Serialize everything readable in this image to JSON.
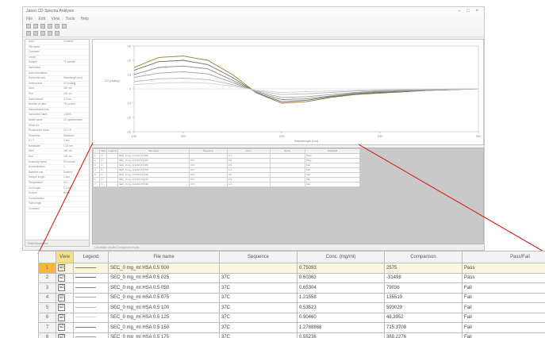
{
  "window": {
    "title": "Jasco CD Spectra Analysis",
    "controls": "– □ ×",
    "menu": [
      "File",
      "Edit",
      "View",
      "Tools",
      "Help"
    ]
  },
  "properties": {
    "rows": [
      {
        "k": "Data",
        "v": "Contents"
      },
      {
        "k": "File name",
        "v": ""
      },
      {
        "k": "Comment",
        "v": ""
      },
      {
        "k": "Owner",
        "v": ""
      },
      {
        "k": "Sample",
        "v": "TF sample"
      },
      {
        "k": "Instrument",
        "v": ""
      },
      {
        "k": "Data information",
        "v": ""
      },
      {
        "k": "Horizontal axis",
        "v": "Wavelength [nm]"
      },
      {
        "k": "Vertical axis",
        "v": "CD [mdeg]"
      },
      {
        "k": "Start",
        "v": "260 nm"
      },
      {
        "k": "End",
        "v": "190 nm"
      },
      {
        "k": "Data interval",
        "v": "0.1 nm"
      },
      {
        "k": "Number of data",
        "v": "701 points"
      },
      {
        "k": "Measurement info",
        "v": ""
      },
      {
        "k": "Instrument name",
        "v": "J-1500"
      },
      {
        "k": "Model name",
        "v": "CD spectrometer"
      },
      {
        "k": "Serial No.",
        "v": ""
      },
      {
        "k": "Photometric mode",
        "v": "CD, HT"
      },
      {
        "k": "Sensitivity",
        "v": "Standard"
      },
      {
        "k": "D.I.T.",
        "v": "2 sec"
      },
      {
        "k": "Bandwidth",
        "v": "1.00 nm"
      },
      {
        "k": "Start",
        "v": "260 nm"
      },
      {
        "k": "End",
        "v": "190 nm"
      },
      {
        "k": "Scanning speed",
        "v": "50 nm/min"
      },
      {
        "k": "Accumulations",
        "v": "1"
      },
      {
        "k": "Baseline corr.",
        "v": "Solvent"
      },
      {
        "k": "Sample length",
        "v": "1 mm"
      },
      {
        "k": "Temperature",
        "v": "25 C"
      },
      {
        "k": "Cell length",
        "v": "0.1 cm"
      },
      {
        "k": "Solvent",
        "v": "Buffer"
      },
      {
        "k": "Concentration",
        "v": ""
      },
      {
        "k": "Path length",
        "v": ""
      },
      {
        "k": "Comment",
        "v": ""
      }
    ],
    "bottom_tab": "Data information"
  },
  "chart_data": {
    "type": "line",
    "xlabel": "Wavelength [nm]",
    "ylabel": "CD [mdeg]",
    "xlim": [
      190,
      260
    ],
    "ylim": [
      -30,
      30
    ],
    "x_ticks": [
      "190",
      "200",
      "220",
      "240",
      "260"
    ],
    "y_ticks": [
      "30",
      "20",
      "10",
      "0",
      "-10",
      "-20",
      "-30"
    ],
    "x": [
      190,
      195,
      200,
      205,
      210,
      215,
      220,
      225,
      230,
      235,
      240,
      245,
      250,
      255,
      260
    ],
    "series": [
      {
        "color": "#9a7a28",
        "values": [
          15,
          22,
          23,
          20,
          10,
          -3,
          -10,
          -9,
          -6,
          -4,
          -3,
          -2,
          -1,
          -0.5,
          0
        ]
      },
      {
        "color": "#6b6b6b",
        "values": [
          13,
          19,
          20,
          17,
          8,
          -3,
          -9,
          -8,
          -5.5,
          -3.5,
          -2.5,
          -2,
          -1,
          -0.5,
          0
        ]
      },
      {
        "color": "#8a8a8a",
        "values": [
          10,
          15,
          16,
          14,
          6,
          -2.5,
          -7.5,
          -7,
          -5,
          -3,
          -2,
          -1.5,
          -1,
          -0.5,
          0
        ]
      },
      {
        "color": "#a0a0a0",
        "values": [
          8,
          11,
          12,
          10.5,
          4.5,
          -2,
          -6,
          -5.5,
          -4,
          -2.5,
          -1.5,
          -1,
          -0.5,
          -0.3,
          0
        ]
      },
      {
        "color": "#b8b8b8",
        "values": [
          5,
          7,
          7.5,
          6.5,
          3,
          -1.5,
          -4,
          -3.5,
          -2.5,
          -1.5,
          -1,
          -0.6,
          -0.3,
          -0.1,
          0
        ]
      },
      {
        "color": "#cfcfcf",
        "values": [
          3,
          4,
          4.5,
          4,
          2,
          -1,
          -2.5,
          -2,
          -1.5,
          -1,
          -0.6,
          -0.3,
          -0.2,
          -0.1,
          0
        ]
      }
    ]
  },
  "small_table": {
    "columns": [
      "",
      "View",
      "Legend",
      "File name",
      "Sequence",
      "Conc.",
      "Comp.",
      "Pass/Fail"
    ],
    "rows": [
      [
        "1",
        "☑",
        "",
        "SEC_0 mg_ml HSA 0.5 000",
        "",
        "0.7",
        "",
        "Pass"
      ],
      [
        "2",
        "☑",
        "",
        "SEC_0 mg_ml HSA 0.5 025",
        "37C",
        "0.6",
        "",
        "Pass"
      ],
      [
        "3",
        "☑",
        "",
        "SEC_0 mg_ml HSA 0.5 050",
        "37C",
        "0.6",
        "",
        "Fail"
      ],
      [
        "4",
        "☑",
        "",
        "SEC_0 mg_ml HSA 0.5 075",
        "37C",
        "1.2",
        "",
        "Fail"
      ],
      [
        "5",
        "☑",
        "",
        "SEC_0 mg_ml HSA 0.5 100",
        "37C",
        "0.5",
        "",
        "Fail"
      ],
      [
        "6",
        "☑",
        "",
        "SEC_0 mg_ml HSA 0.5 125",
        "37C",
        "0.9",
        "",
        "Fail"
      ],
      [
        "7",
        "☑",
        "",
        "SEC_0 mg_ml HSA 0.5 150",
        "37C",
        "1.2",
        "",
        "Fail"
      ]
    ]
  },
  "statusbar": "Calculation results   Comparison results",
  "big_table": {
    "columns": [
      "",
      "View",
      "Legend",
      "File name",
      "Sequence",
      "Conc. (mg/ml)",
      "Comparison",
      "Pass/Fail"
    ],
    "rows": [
      {
        "n": "1",
        "view": "☑",
        "color": "#9a7a28",
        "file": "SEC_0 mg_ml HSA 0.5 000",
        "seq": "",
        "conc": "0.75093",
        "cmp": "2575",
        "pf": "Pass"
      },
      {
        "n": "2",
        "view": "☑",
        "color": "#6b6b6b",
        "file": "SEC_0 mg_ml HSA 0.5 025",
        "seq": "37C",
        "conc": "0.60363",
        "cmp": "-31498",
        "pf": "Pass"
      },
      {
        "n": "3",
        "view": "☑",
        "color": "#8a8a8a",
        "file": "SEC_0 mg_ml HSA 0.5 050",
        "seq": "37C",
        "conc": "0.65304",
        "cmp": "79036",
        "pf": "Fail"
      },
      {
        "n": "4",
        "view": "☑",
        "color": "#a0a0a0",
        "file": "SEC_0 mg_ml HSA 0.5 075",
        "seq": "37C",
        "conc": "1.21558",
        "cmp": "135519",
        "pf": "Fail"
      },
      {
        "n": "5",
        "view": "☑",
        "color": "#b8b8b8",
        "file": "SEC_0 mg_ml HSA 0.5 100",
        "seq": "37C",
        "conc": "0.53523",
        "cmp": "593029",
        "pf": "Fail"
      },
      {
        "n": "6",
        "view": "☑",
        "color": "#cfcfcf",
        "file": "SEC_0 mg_ml HSA 0.5 125",
        "seq": "37C",
        "conc": "0.90460",
        "cmp": "48.2952",
        "pf": "Fail"
      },
      {
        "n": "7",
        "view": "☑",
        "color": "#7a7a7a",
        "file": "SEC_0 mg_ml HSA 0.5 150",
        "seq": "37C",
        "conc": "1.2788868",
        "cmp": "715.3708",
        "pf": "Fail"
      },
      {
        "n": "8",
        "view": "☑",
        "color": "#999999",
        "file": "SEC_0 mg_ml HSA 0.5 175",
        "seq": "37C",
        "conc": "0.55236",
        "cmp": "369.2276",
        "pf": "Fail"
      }
    ]
  }
}
